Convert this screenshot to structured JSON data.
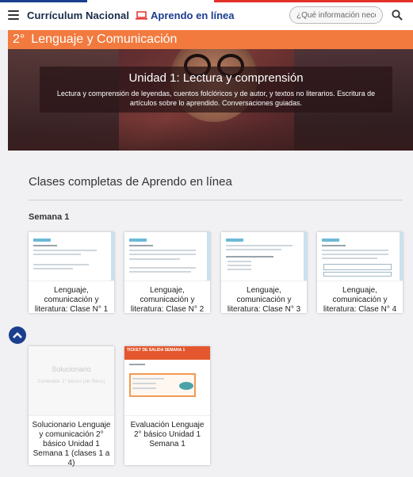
{
  "header": {
    "brand": "Currículum Nacional",
    "aprendo": "Aprendo en línea",
    "search_placeholder": "¿Qué información necesitas?"
  },
  "grade": {
    "number": "2°",
    "subject": "Lenguaje y Comunicación"
  },
  "hero": {
    "title": "Unidad 1: Lectura y comprensión",
    "description": "Lectura y comprensión de leyendas, cuentos folclóricos y de autor, y textos no literarios. Escritura de artículos sobre lo aprendido. Conversaciones guiadas."
  },
  "content": {
    "section_title": "Clases completas de Aprendo en línea",
    "week_label": "Semana 1",
    "cards": [
      {
        "label": "Lenguaje, comunicación y literatura: Clase N° 1"
      },
      {
        "label": "Lenguaje, comunicación y literatura: Clase N° 2"
      },
      {
        "label": "Lenguaje, comunicación y literatura: Clase N° 3"
      },
      {
        "label": "Lenguaje, comunicación y literatura: Clase N° 4"
      },
      {
        "label": "Solucionario Lenguaje y comunicación 2° básico Unidad 1 Semana 1 (clases 1 a 4)"
      },
      {
        "label": "Evaluación Lenguaje 2° básico Unidad 1 Semana 1"
      }
    ],
    "solucionario_thumb_title": "Solucionario",
    "solucionario_thumb_sub": "Contenido: 2° básico (sin filtros)",
    "evaluacion_thumb_head": "TICKET DE SALIDA SEMANA 1"
  },
  "colors": {
    "orange": "#f27a3f",
    "navy": "#1a2a48",
    "blue": "#1b3d8f",
    "tricolor": [
      "#1b3f8f",
      "#ffffff",
      "#e4302b"
    ]
  }
}
